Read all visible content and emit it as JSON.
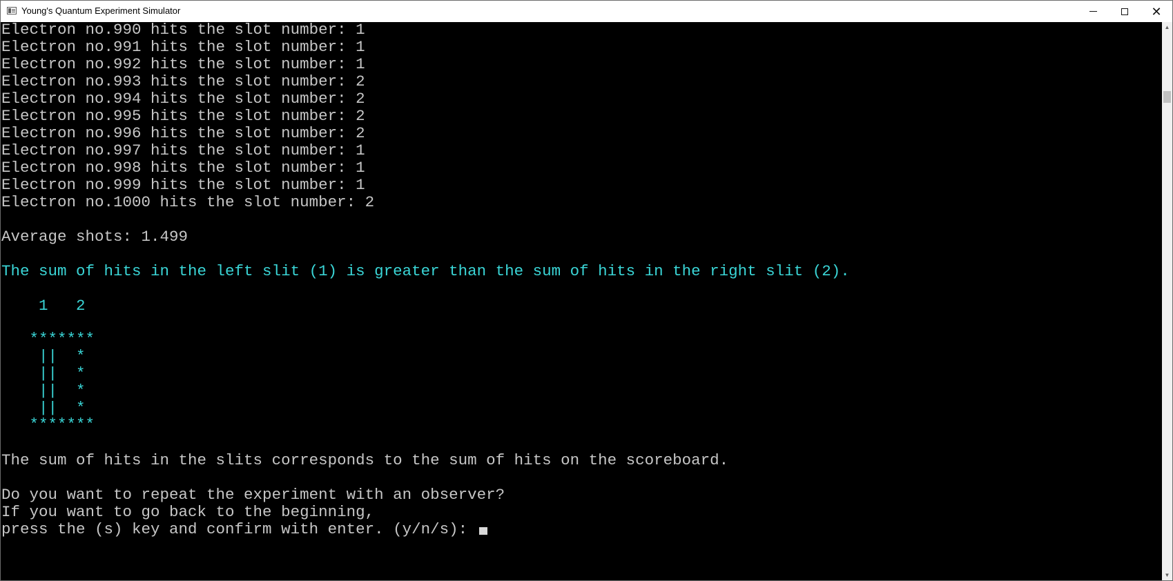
{
  "window": {
    "title": "Young's Quantum Experiment Simulator",
    "app_icon": "console-window-icon",
    "controls": {
      "minimize": "minimize-icon",
      "maximize": "maximize-icon",
      "close": "close-icon"
    }
  },
  "console": {
    "electron_lines": [
      "Electron no.990 hits the slot number: 1",
      "Electron no.991 hits the slot number: 1",
      "Electron no.992 hits the slot number: 1",
      "Electron no.993 hits the slot number: 2",
      "Electron no.994 hits the slot number: 2",
      "Electron no.995 hits the slot number: 2",
      "Electron no.996 hits the slot number: 2",
      "Electron no.997 hits the slot number: 1",
      "Electron no.998 hits the slot number: 1",
      "Electron no.999 hits the slot number: 1",
      "Electron no.1000 hits the slot number: 2"
    ],
    "average": "Average shots: 1.499",
    "comparison": "The sum of hits in the left slit (1) is greater than the sum of hits in the right slit (2).",
    "diagram": [
      "    1   2",
      "",
      "   *******",
      "    ||  *",
      "    ||  *",
      "    ||  *",
      "    ||  *",
      "   *******"
    ],
    "scoreboard": "The sum of hits in the slits corresponds to the sum of hits on the scoreboard.",
    "prompt": [
      "Do you want to repeat the experiment with an observer?",
      "If you want to go back to the beginning,",
      "press the (s) key and confirm with enter. (y/n/s): "
    ]
  },
  "colors": {
    "background": "#000000",
    "text": "#c6c6c6",
    "highlight": "#3ad5d6"
  }
}
